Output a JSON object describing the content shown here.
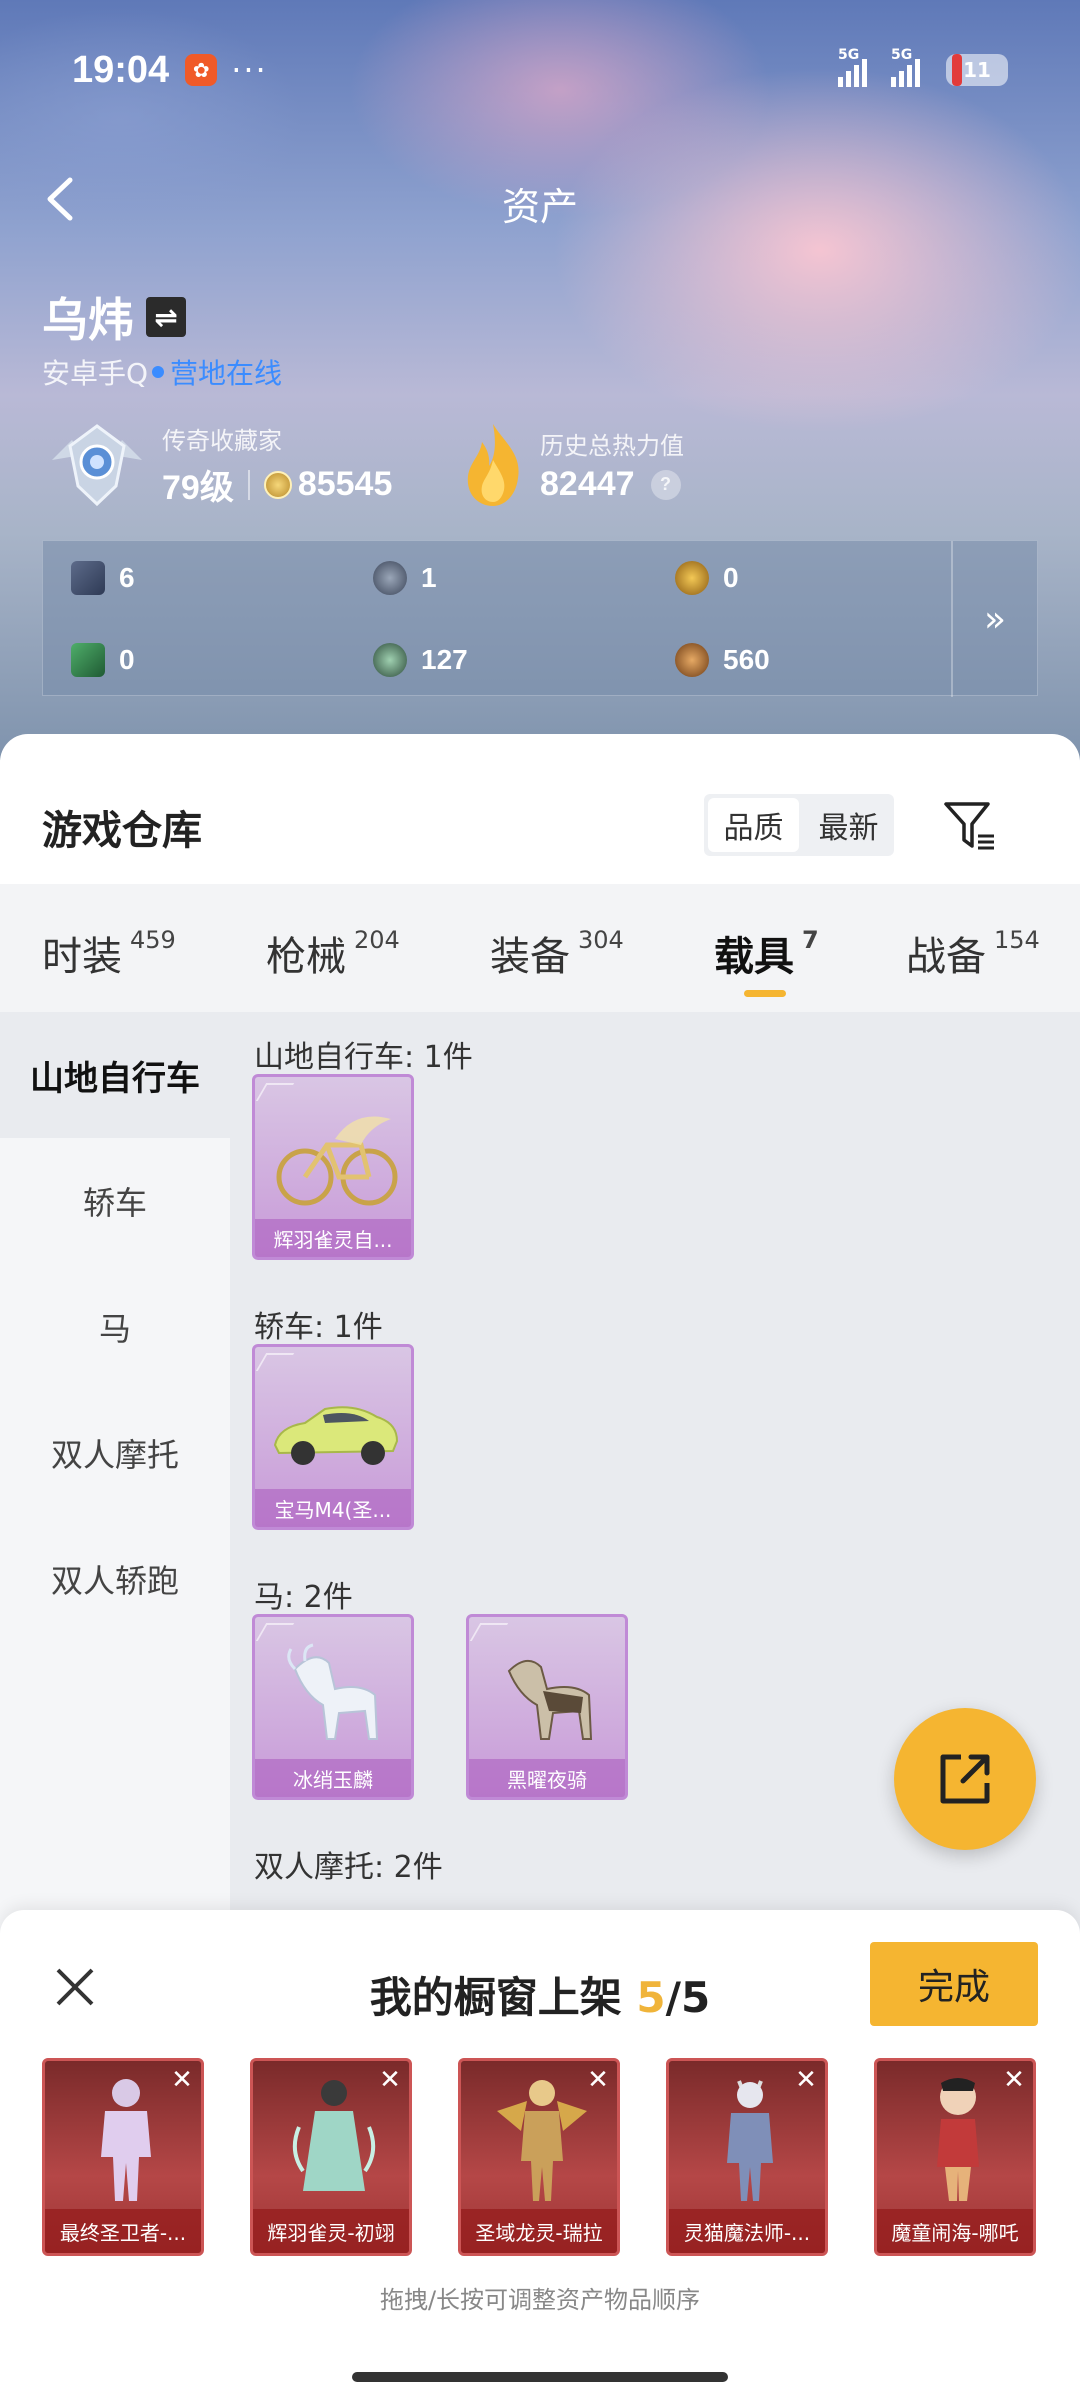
{
  "status_bar": {
    "time": "19:04",
    "signal1": "5G",
    "signal2": "5G",
    "battery": "11"
  },
  "nav": {
    "title": "资产"
  },
  "profile": {
    "name": "乌炜",
    "platform": "安卓手Q",
    "online_status": "营地在线",
    "collector_label": "传奇收藏家",
    "level": "79级",
    "coins": "85545",
    "heat_label": "历史总热力值",
    "heat_value": "82447"
  },
  "stats": [
    {
      "icon": "card-icon",
      "value": "6"
    },
    {
      "icon": "emblem-icon",
      "value": "1"
    },
    {
      "icon": "gold-emblem-icon",
      "value": "0"
    },
    {
      "icon": "green-card-icon",
      "value": "0"
    },
    {
      "icon": "gem-icon",
      "value": "127"
    },
    {
      "icon": "bronze-coin-icon",
      "value": "560"
    }
  ],
  "warehouse": {
    "title": "游戏仓库",
    "sort": {
      "quality": "品质",
      "newest": "最新"
    },
    "tabs": [
      {
        "label": "时装",
        "count": "459"
      },
      {
        "label": "枪械",
        "count": "204"
      },
      {
        "label": "装备",
        "count": "304"
      },
      {
        "label": "载具",
        "count": "7"
      },
      {
        "label": "战备",
        "count": "154"
      }
    ],
    "categories": [
      "山地自行车",
      "轿车",
      "马",
      "双人摩托",
      "双人轿跑"
    ],
    "groups": [
      {
        "title": "山地自行车: 1件",
        "items": [
          "辉羽雀灵自..."
        ]
      },
      {
        "title": "轿车: 1件",
        "items": [
          "宝马M4(圣..."
        ]
      },
      {
        "title": "马: 2件",
        "items": [
          "冰绡玉麟",
          "黑曜夜骑"
        ]
      },
      {
        "title": "双人摩托: 2件",
        "items": []
      }
    ]
  },
  "showcase": {
    "title_prefix": "我的橱窗上架 ",
    "current": "5",
    "total": "/5",
    "done_label": "完成",
    "slots": [
      "最终圣卫者-...",
      "辉羽雀灵-初翊",
      "圣域龙灵-瑞拉",
      "灵猫魔法师-...",
      "魔童闹海-哪吒"
    ],
    "hint": "拖拽/长按可调整资产物品顺序"
  },
  "colors": {
    "accent": "#f5b531",
    "online": "#3b8cff",
    "card_purple": "#c89ad8",
    "card_red": "#b54747"
  }
}
